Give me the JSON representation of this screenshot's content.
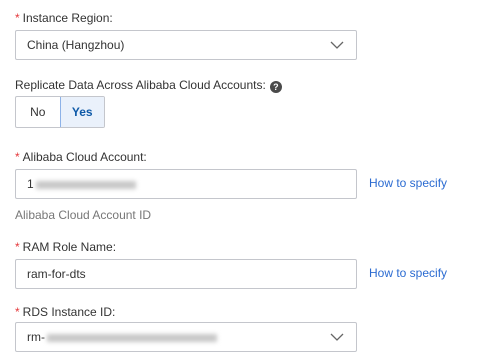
{
  "instance_region": {
    "required_mark": "*",
    "label": "Instance Region:",
    "value": "China (Hangzhou)"
  },
  "replicate": {
    "label": "Replicate Data Across Alibaba Cloud Accounts:",
    "help_icon": "question-circle-icon",
    "options": [
      "No",
      "Yes"
    ],
    "selected": "Yes"
  },
  "account": {
    "required_mark": "*",
    "label": "Alibaba Cloud Account:",
    "value_prefix": "1",
    "link": "How to specify",
    "help": "Alibaba Cloud Account ID"
  },
  "ram_role": {
    "required_mark": "*",
    "label": "RAM Role Name:",
    "value": "ram-for-dts",
    "link": "How to specify"
  },
  "rds_instance": {
    "required_mark": "*",
    "label": "RDS Instance ID:",
    "value_prefix": "rm-"
  },
  "colors": {
    "required": "#e4393c",
    "link": "#2b6bd1",
    "selected_bg": "#eaf1fb"
  }
}
